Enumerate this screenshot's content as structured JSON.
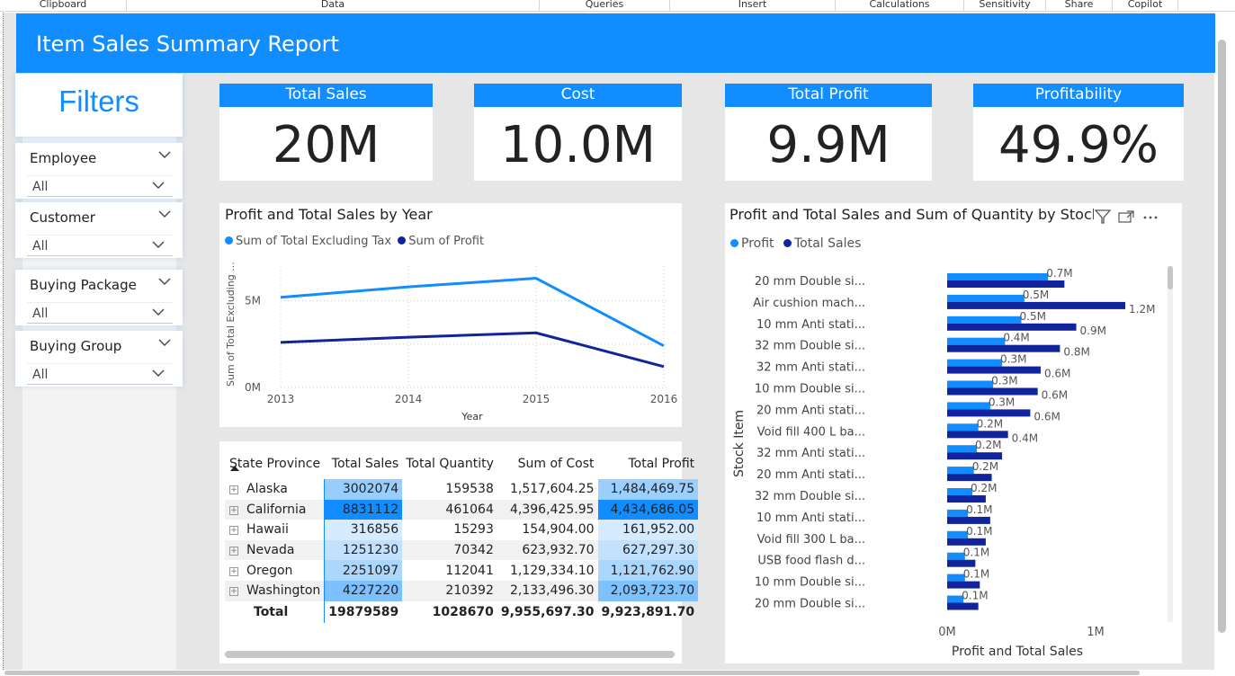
{
  "ribbon": {
    "groups": [
      "Clipboard",
      "Data",
      "Queries",
      "Insert",
      "Calculations",
      "Sensitivity",
      "Share",
      "Copilot"
    ]
  },
  "report": {
    "title": "Item Sales Summary Report"
  },
  "filters": {
    "heading": "Filters",
    "slicers": [
      {
        "label": "Employee",
        "value": "All"
      },
      {
        "label": "Customer",
        "value": "All"
      },
      {
        "label": "Buying Package",
        "value": "All"
      },
      {
        "label": "Buying Group",
        "value": "All"
      }
    ]
  },
  "kpis": [
    {
      "label": "Total Sales",
      "value": "20M"
    },
    {
      "label": "Cost",
      "value": "10.0M"
    },
    {
      "label": "Total Profit",
      "value": "9.9M"
    },
    {
      "label": "Profitability",
      "value": "49.9%"
    }
  ],
  "colors": {
    "accent": "#118dff",
    "dark_series": "#12239e"
  },
  "chart_data": [
    {
      "type": "line",
      "title": "Profit and Total Sales by Year",
      "xlabel": "Year",
      "ylabel": "Sum of Total Excluding ...",
      "x": [
        "2013",
        "2014",
        "2015",
        "2016"
      ],
      "ylim": [
        0,
        7000000
      ],
      "yticks": [
        "0M",
        "5M"
      ],
      "series": [
        {
          "name": "Sum of Total Excluding Tax",
          "color": "#118dff",
          "values": [
            5200000,
            5800000,
            6300000,
            2400000
          ]
        },
        {
          "name": "Sum of Profit",
          "color": "#12239e",
          "values": [
            2600000,
            2900000,
            3150000,
            1200000
          ]
        }
      ],
      "legend": "top-left",
      "grid": true
    },
    {
      "type": "bar",
      "orientation": "horizontal",
      "title": "Profit and Total Sales and Sum of Quantity by Stock I",
      "ylabel": "Stock Item",
      "xlabel": "Profit and Total Sales",
      "xticks": [
        "0M",
        "1M"
      ],
      "xlim": [
        0,
        1300000
      ],
      "categories": [
        "20 mm Double si...",
        "Air cushion mach...",
        "10 mm Anti stati...",
        "32 mm Double si...",
        "32 mm Anti stati...",
        "10 mm Double si...",
        "20 mm Anti stati...",
        "Void fill 400 L ba...",
        "32 mm Anti stati...",
        "20 mm Anti stati...",
        "32 mm Double si...",
        "10 mm Anti stati...",
        "Void fill 300 L ba...",
        "USB food flash d...",
        "10 mm Double si...",
        "20 mm Double si..."
      ],
      "series": [
        {
          "name": "Profit",
          "color": "#118dff",
          "values": [
            680000,
            520000,
            500000,
            390000,
            370000,
            310000,
            290000,
            210000,
            200000,
            180000,
            170000,
            140000,
            140000,
            120000,
            120000,
            110000
          ],
          "labels": [
            "0.7M",
            "0.5M",
            "0.5M",
            "0.4M",
            "0.3M",
            "0.3M",
            "0.3M",
            "0.2M",
            "0.2M",
            "0.2M",
            "0.2M",
            "0.1M",
            "0.1M",
            "0.1M",
            "0.1M",
            "0.1M"
          ]
        },
        {
          "name": "Total Sales",
          "color": "#12239e",
          "values": [
            790000,
            1200000,
            870000,
            760000,
            630000,
            610000,
            560000,
            410000,
            370000,
            300000,
            260000,
            290000,
            260000,
            190000,
            220000,
            210000
          ],
          "labels": [
            "",
            "1.2M",
            "0.9M",
            "0.8M",
            "0.6M",
            "0.6M",
            "0.6M",
            "0.4M",
            "",
            "",
            "",
            "",
            "",
            "",
            "",
            ""
          ]
        }
      ],
      "legend": "top-left"
    }
  ],
  "matrix": {
    "columns": [
      "State Province",
      "Total Sales",
      "Total Quantity",
      "Sum of Cost",
      "Total Profit"
    ],
    "rows": [
      {
        "state": "Alaska",
        "sales": "3002074",
        "qty": "159538",
        "cost": "1,517,604.25",
        "profit": "1,484,469.75"
      },
      {
        "state": "California",
        "sales": "8831112",
        "qty": "461064",
        "cost": "4,396,425.95",
        "profit": "4,434,686.05"
      },
      {
        "state": "Hawaii",
        "sales": "316856",
        "qty": "15293",
        "cost": "154,904.00",
        "profit": "161,952.00"
      },
      {
        "state": "Nevada",
        "sales": "1251230",
        "qty": "70342",
        "cost": "623,932.70",
        "profit": "627,297.30"
      },
      {
        "state": "Oregon",
        "sales": "2251097",
        "qty": "112041",
        "cost": "1,129,334.10",
        "profit": "1,121,762.90"
      },
      {
        "state": "Washington",
        "sales": "4227220",
        "qty": "210392",
        "cost": "2,133,496.30",
        "profit": "2,093,723.70"
      }
    ],
    "total": {
      "label": "Total",
      "sales": "19879589",
      "qty": "1028670",
      "cost": "9,955,697.30",
      "profit": "9,923,891.70"
    },
    "sales_fill": [
      0.34,
      1.0,
      0.04,
      0.14,
      0.25,
      0.48
    ],
    "profit_fill": [
      0.33,
      1.0,
      0.04,
      0.14,
      0.25,
      0.47
    ]
  }
}
